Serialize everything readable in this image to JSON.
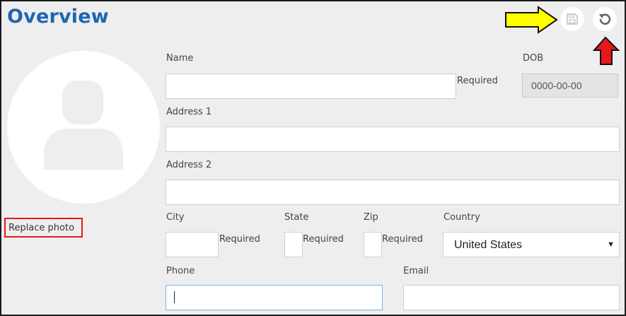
{
  "header": {
    "title": "Overview"
  },
  "toolbar": {
    "save_icon": "floppy-disk-icon",
    "reset_icon": "undo-icon"
  },
  "annotations": {
    "yellow_arrow": "#ffff00",
    "red_arrow": "#e5181b",
    "red_box": "#e5181b"
  },
  "photo": {
    "replace_label": "Replace photo"
  },
  "form": {
    "name": {
      "label": "Name",
      "value": "",
      "required": "Required"
    },
    "dob": {
      "label": "DOB",
      "value": "0000-00-00"
    },
    "address1": {
      "label": "Address 1",
      "value": ""
    },
    "address2": {
      "label": "Address 2",
      "value": ""
    },
    "city": {
      "label": "City",
      "value": "",
      "required": "Required"
    },
    "state": {
      "label": "State",
      "value": "",
      "required": "Required"
    },
    "zip": {
      "label": "Zip",
      "value": "",
      "required": "Required"
    },
    "country": {
      "label": "Country",
      "value": "United States"
    },
    "phone": {
      "label": "Phone",
      "value": ""
    },
    "email": {
      "label": "Email",
      "value": ""
    }
  }
}
